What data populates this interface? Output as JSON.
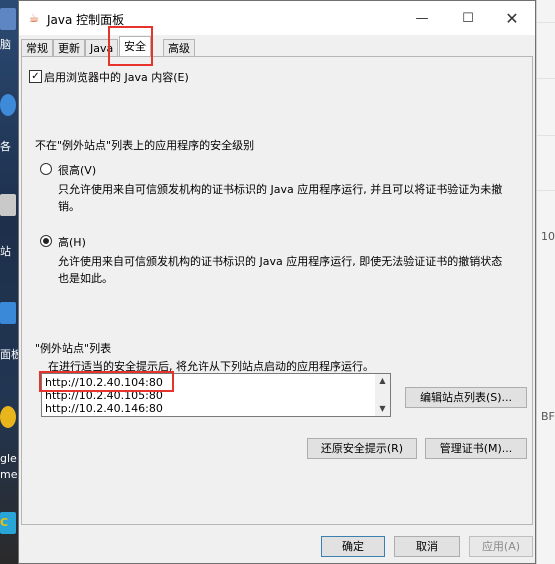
{
  "desktop": {
    "labels": [
      "脑",
      "各",
      "站",
      "面板",
      "gle",
      "me",
      "C"
    ],
    "right_text": [
      "10",
      "BF"
    ]
  },
  "window": {
    "title": "Java 控制面板",
    "minimize": "—",
    "maximize": "☐",
    "close": "✕"
  },
  "tabs": [
    "常规",
    "更新",
    "Java",
    "安全",
    "高级"
  ],
  "enable_java": {
    "checked_glyph": "✓",
    "label": "启用浏览器中的 Java 内容(E)"
  },
  "security_level": {
    "heading": "不在\"例外站点\"列表上的应用程序的安全级别",
    "very_high": {
      "label": "很高(V)",
      "description": "只允许使用来自可信颁发机构的证书标识的 Java 应用程序运行, 并且可以将证书验证为未撤销。"
    },
    "high": {
      "label": "高(H)",
      "description": "允许使用来自可信颁发机构的证书标识的 Java 应用程序运行, 即使无法验证证书的撤销状态也是如此。"
    }
  },
  "exception_sites": {
    "heading": "\"例外站点\"列表",
    "note": "在进行适当的安全提示后, 将允许从下列站点启动的应用程序运行。",
    "sites": [
      "http://10.2.40.104:80",
      "http://10.2.40.105:80",
      "http://10.2.40.146:80"
    ],
    "edit_button": "编辑站点列表(S)..."
  },
  "buttons": {
    "restore_prompts": "还原安全提示(R)",
    "manage_certs": "管理证书(M)...",
    "ok": "确定",
    "cancel": "取消",
    "apply": "应用(A)"
  },
  "colors": {
    "highlight": "#e8322c"
  }
}
